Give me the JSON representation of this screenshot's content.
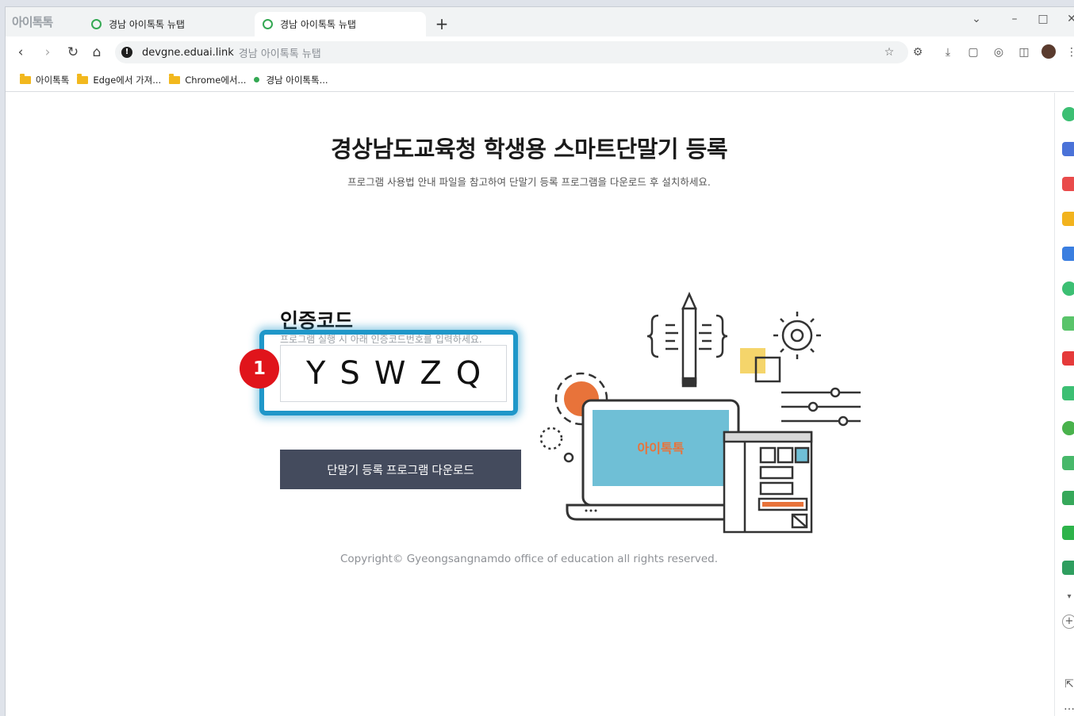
{
  "browser": {
    "logo_text": "아이톡톡",
    "tabs": [
      {
        "label": "경남 아이톡톡 뉴탭",
        "active": false
      },
      {
        "label": "경남 아이톡톡 뉴탭",
        "active": true
      }
    ],
    "new_tab_label": "+",
    "address": {
      "host": "devgne.eduai.link",
      "page_title": "경남 아이톡톡 뉴탭"
    },
    "bookmarks": [
      {
        "label": "아이톡톡",
        "icon": "folder-icon"
      },
      {
        "label": "Edge에서 가져...",
        "icon": "folder-icon"
      },
      {
        "label": "Chrome에서...",
        "icon": "folder-icon"
      },
      {
        "label": "경남 아이톡톡...",
        "icon": "green-dot-icon"
      }
    ],
    "side_panel_icons": [
      "green-circle-icon",
      "briefcase-icon",
      "pocket-icon",
      "star-icon",
      "google-icon",
      "play-icon",
      "chat-icon",
      "news-icon",
      "green-app-icon",
      "ebook-icon",
      "message-icon",
      "gift-icon",
      "naver-icon",
      "map-icon"
    ]
  },
  "page": {
    "title": "경상남도교육청 학생용 스마트단말기 등록",
    "subtitle": "프로그램 사용법 안내 파일을 참고하여 단말기 등록 프로그램을 다운로드 후 설치하세요.",
    "code_label": "인증코드",
    "code_hint": "프로그램 실행 시 아래 인증코드번호를 입력하세요.",
    "auth_code": "YSWZQ",
    "step_badge": "1",
    "download_button": "단말기 등록 프로그램 다운로드",
    "illustration_logo": "아이톡톡",
    "copyright": "Copyright© Gyeongsangnamdo office of education all rights reserved."
  },
  "colors": {
    "highlight": "#1f97c9",
    "badge": "#e0141b",
    "button": "#444b5d",
    "screen": "#6fbfd6",
    "accent_orange": "#e8733a",
    "accent_yellow": "#f5d56b"
  }
}
